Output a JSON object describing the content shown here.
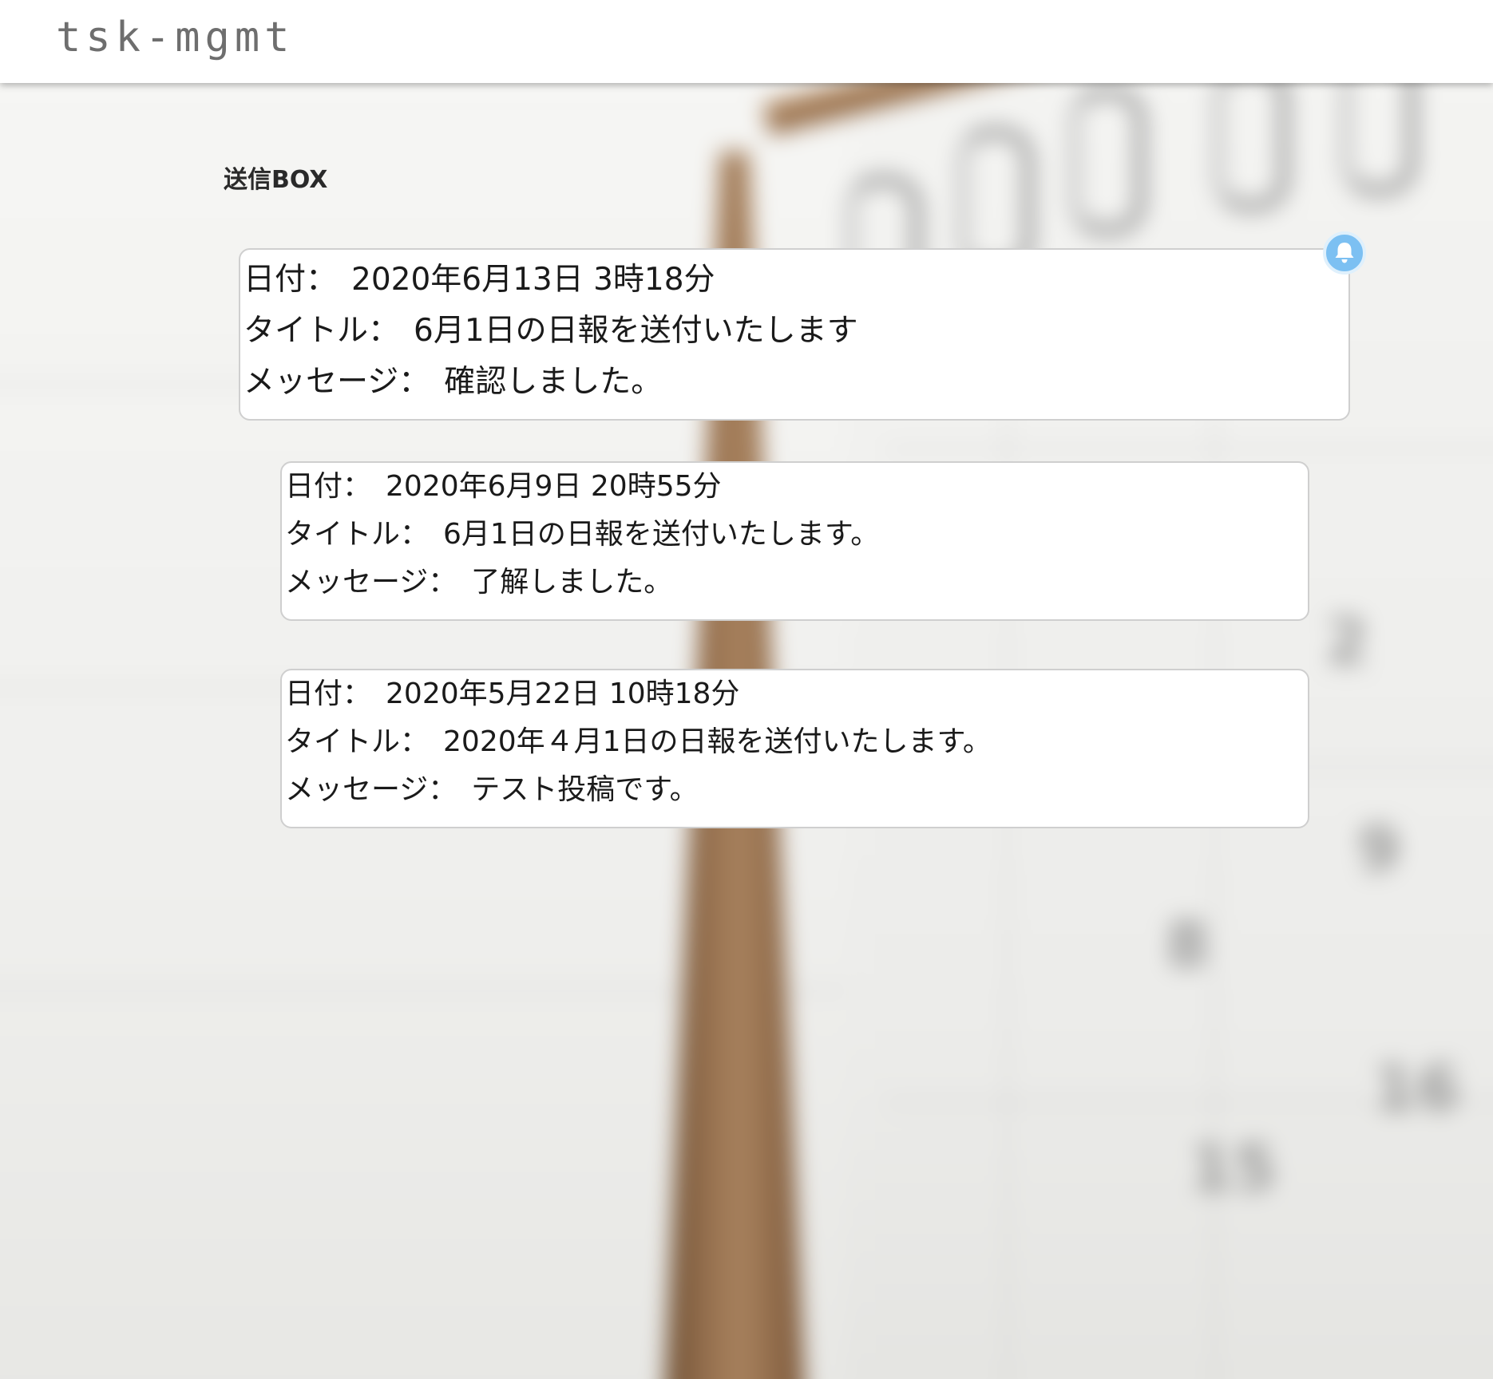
{
  "app": {
    "logo": "tsk-mgmt"
  },
  "page": {
    "section_title": "送信BOX"
  },
  "labels": {
    "date": "日付：",
    "title": "タイトル：",
    "message": "メッセージ："
  },
  "messages": [
    {
      "date": "2020年6月13日 3時18分",
      "title": "6月1日の日報を送付いたします",
      "message": "確認しました。",
      "has_notification": true
    },
    {
      "date": "2020年6月9日 20時55分",
      "title": "6月1日の日報を送付いたします。",
      "message": "了解しました。",
      "has_notification": false
    },
    {
      "date": "2020年5月22日 10時18分",
      "title": "2020年４月1日の日報を送付いたします。",
      "message": "テスト投稿です。",
      "has_notification": false
    }
  ],
  "icons": {
    "notification": "bell-icon"
  },
  "colors": {
    "notification_badge": "#7cc0f2",
    "logo_text": "#6e6e6e"
  }
}
